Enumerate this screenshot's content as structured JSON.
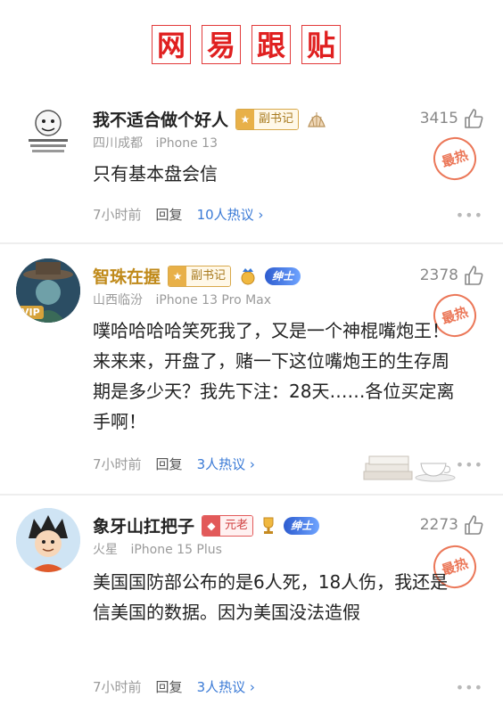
{
  "header": {
    "title_chars": [
      "网",
      "易",
      "跟",
      "贴"
    ]
  },
  "comments": [
    {
      "username": "我不适合做个好人",
      "badge_label": "副书记",
      "location": "四川成都",
      "device": "iPhone 13",
      "like_count": "3415",
      "hot_label": "最热",
      "text": "只有基本盘会信",
      "time": "7小时前",
      "reply_label": "回复",
      "hot_discuss": "10人热议 ›",
      "avatar_text": "我不适合\n做个好人"
    },
    {
      "username": "智珠在握",
      "badge_label": "副书记",
      "vip_label": "绅士",
      "location": "山西临汾",
      "device": "iPhone 13 Pro Max",
      "like_count": "2378",
      "hot_label": "最热",
      "text": "噗哈哈哈哈笑死我了，又是一个神棍嘴炮王！来来来，开盘了，赌一下这位嘴炮王的生存周期是多少天？我先下注：28天……各位买定离手啊！",
      "time": "7小时前",
      "reply_label": "回复",
      "hot_discuss": "3人热议 ›",
      "avatar_vip": "VIP"
    },
    {
      "username": "象牙山扛把子",
      "badge_label": "元老",
      "vip_label": "绅士",
      "location": "火星",
      "device": "iPhone 15 Plus",
      "like_count": "2273",
      "hot_label": "最热",
      "text": "美国国防部公布的是6人死，18人伤，我还是信美国的数据。因为美国没法造假",
      "time": "7小时前",
      "reply_label": "回复",
      "hot_discuss": "3人热议 ›"
    }
  ],
  "colors": {
    "title_red": "#e02020",
    "hot_orange": "#e8603c",
    "link_blue": "#3a7ad6"
  }
}
